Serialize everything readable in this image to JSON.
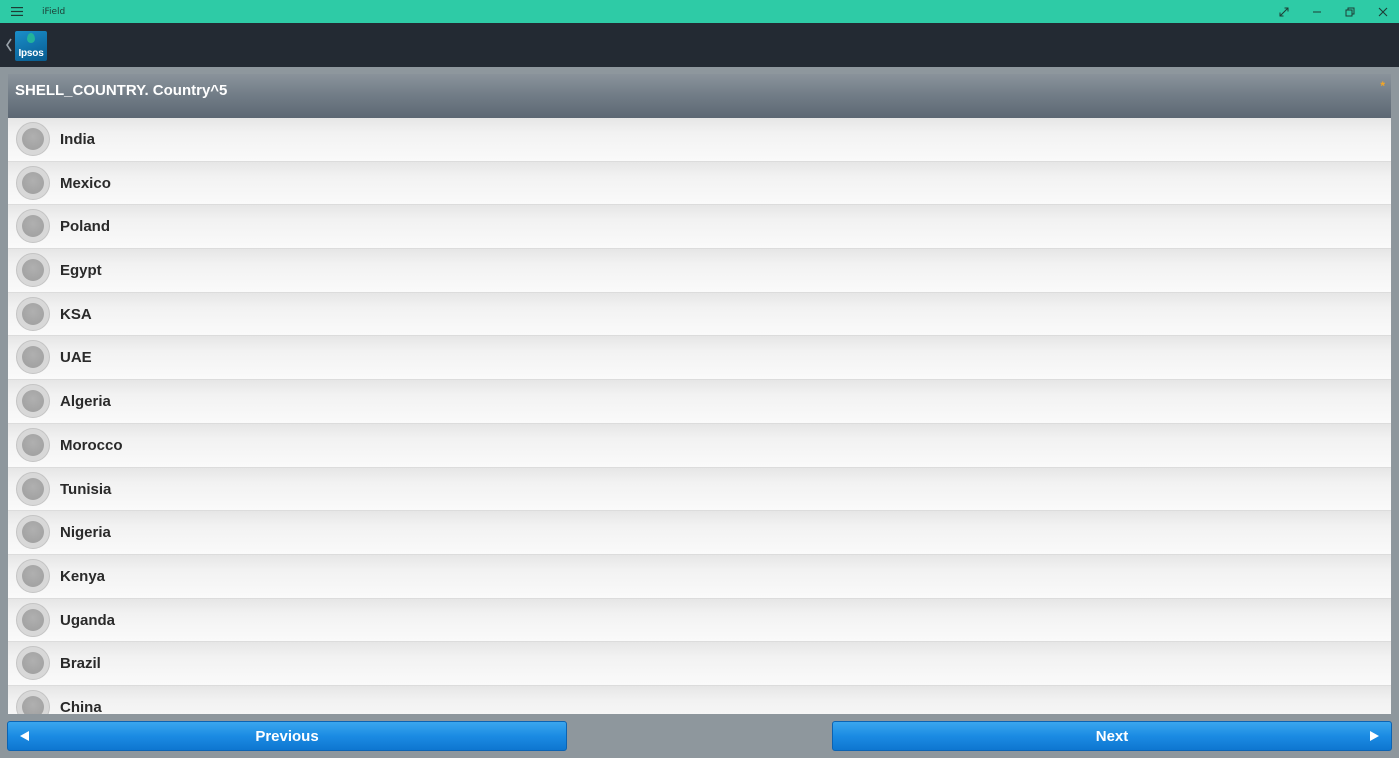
{
  "window": {
    "title": "iField"
  },
  "header": {
    "logo_text": "Ipsos"
  },
  "question": {
    "title": "SHELL_COUNTRY. Country^5",
    "required_marker": "*",
    "options": [
      {
        "label": "India",
        "selected": false
      },
      {
        "label": "Mexico",
        "selected": false
      },
      {
        "label": "Poland",
        "selected": false
      },
      {
        "label": "Egypt",
        "selected": false
      },
      {
        "label": "KSA",
        "selected": false
      },
      {
        "label": "UAE",
        "selected": false
      },
      {
        "label": "Algeria",
        "selected": false
      },
      {
        "label": "Morocco",
        "selected": false
      },
      {
        "label": "Tunisia",
        "selected": false
      },
      {
        "label": "Nigeria",
        "selected": false
      },
      {
        "label": "Kenya",
        "selected": false
      },
      {
        "label": "Uganda",
        "selected": false
      },
      {
        "label": "Brazil",
        "selected": false
      },
      {
        "label": "China",
        "selected": false
      }
    ]
  },
  "navigation": {
    "previous_label": "Previous",
    "next_label": "Next"
  },
  "colors": {
    "titlebar": "#2ecba6",
    "app_header": "#232a33",
    "button": "#1b8be3",
    "required": "#f5a623"
  }
}
